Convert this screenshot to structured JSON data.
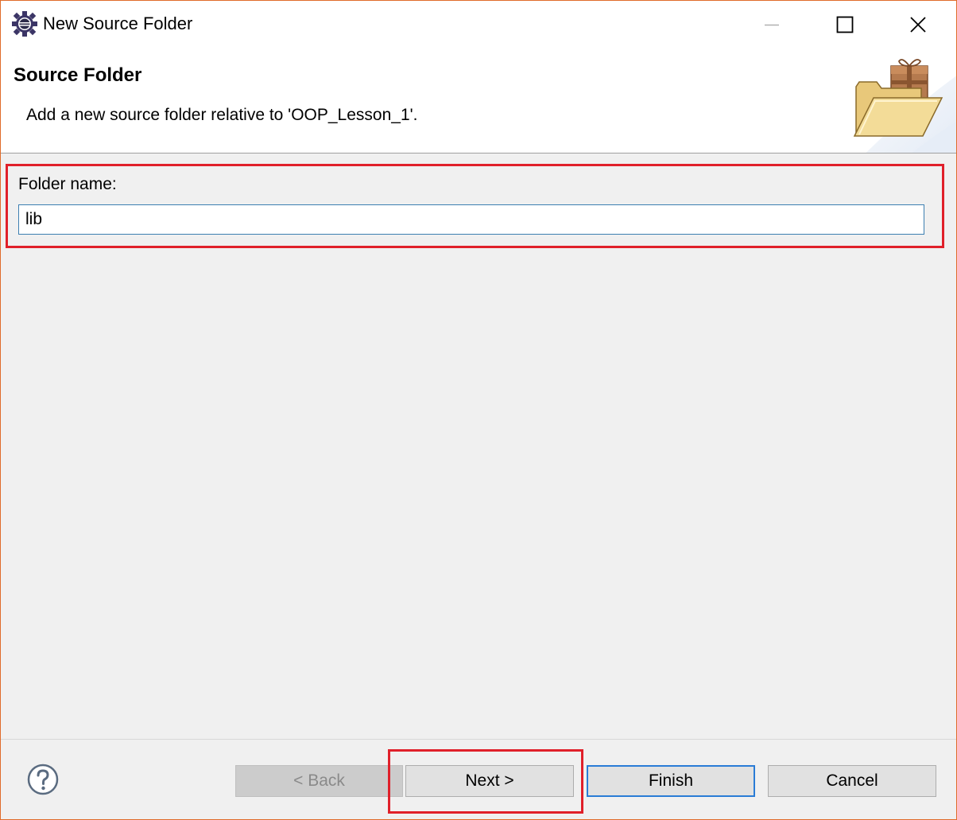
{
  "window": {
    "title": "New Source Folder",
    "icon": "eclipse-gear-icon",
    "controls": {
      "minimize": "minimize-icon",
      "maximize": "maximize-icon",
      "close": "close-icon"
    }
  },
  "banner": {
    "title": "Source Folder",
    "description": "Add a new source folder relative to 'OOP_Lesson_1'.",
    "icon": "folder-with-package-icon"
  },
  "form": {
    "folder_name_label": "Folder name:",
    "folder_name_value": "lib"
  },
  "buttons": {
    "help_icon": "help-question-icon",
    "back": "< Back",
    "next": "Next >",
    "finish": "Finish",
    "cancel": "Cancel",
    "back_enabled": false
  },
  "colors": {
    "window_border": "#e06b2a",
    "highlight": "#e0202a",
    "default_button_border": "#2a7cd6",
    "input_border": "#3c7fb1"
  }
}
